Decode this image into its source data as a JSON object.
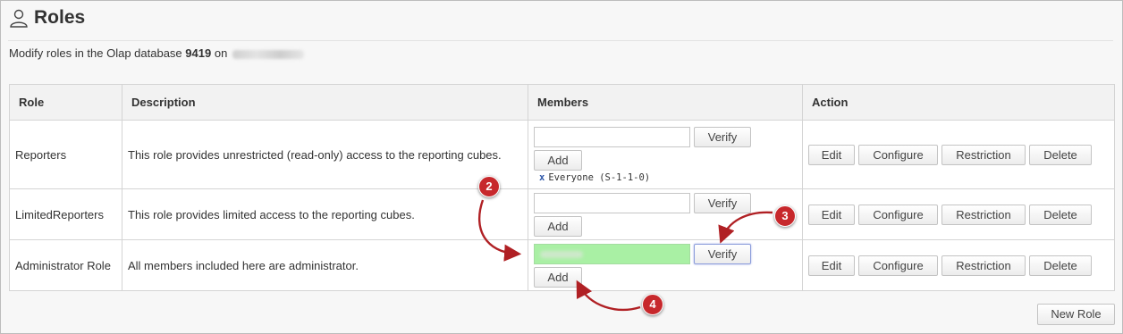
{
  "header": {
    "title": "Roles",
    "subtitle_prefix": "Modify roles in the Olap database",
    "database_id": "9419",
    "subtitle_on": "on"
  },
  "table": {
    "headers": [
      "Role",
      "Description",
      "Members",
      "Action"
    ],
    "rows": [
      {
        "role": "Reporters",
        "description": "This role provides unrestricted (read-only) access to the reporting cubes.",
        "member_entry": "Everyone (S-1-1-0)",
        "remove_glyph": "x"
      },
      {
        "role": "LimitedReporters",
        "description": "This role provides limited access to the reporting cubes."
      },
      {
        "role": "Administrator Role",
        "description": "All members included here are administrator."
      }
    ]
  },
  "buttons": {
    "verify": "Verify",
    "add": "Add",
    "edit": "Edit",
    "configure": "Configure",
    "restriction": "Restriction",
    "delete": "Delete",
    "new_role": "New Role"
  },
  "annotations": [
    "2",
    "3",
    "4"
  ],
  "colors": {
    "badge": "#c7282c",
    "highlight_input": "#a9f0a4",
    "verify_focus": "#8c9ddb"
  },
  "icons": {
    "title": "user-icon"
  }
}
